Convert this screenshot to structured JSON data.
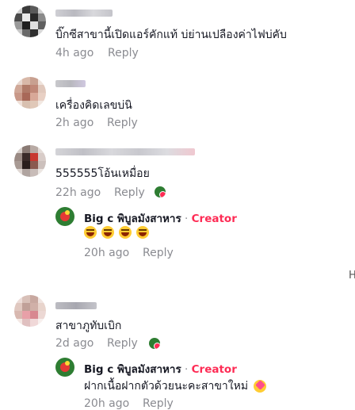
{
  "comments": [
    {
      "text": "บิ๊กซีสาขานี้เปิดแอร์คักแท้ บ่ย่านเปลืองค่าไฟบ่คับ",
      "time": "4h ago",
      "reply_label": "Reply"
    },
    {
      "text": "เครื่องคิดเลขบ่นิ",
      "time": "2h ago",
      "reply_label": "Reply"
    },
    {
      "text": "555555โอ้นเหมื่อย",
      "time": "22h ago",
      "reply_label": "Reply",
      "creator_liked": true,
      "creator_reply": {
        "name": "Big c พิบูลมังสาหาร",
        "separator": " · ",
        "badge": "Creator",
        "emoji_count": 4,
        "time": "20h ago",
        "reply_label": "Reply"
      }
    },
    {
      "text": "สาขาภูทับเบิก",
      "time": "2d ago",
      "reply_label": "Reply",
      "creator_liked": true,
      "creator_reply": {
        "name": "Big c พิบูลมังสาหาร",
        "separator": " · ",
        "badge": "Creator",
        "text": "ฝากเนื้อฝากตัวด้วยนะคะสาขาใหม่",
        "time": "20h ago",
        "reply_label": "Reply"
      }
    }
  ],
  "edge_hint": "H",
  "colors": {
    "creator": "#fe2c55",
    "meta": "#8a8b91",
    "text": "#161823"
  }
}
